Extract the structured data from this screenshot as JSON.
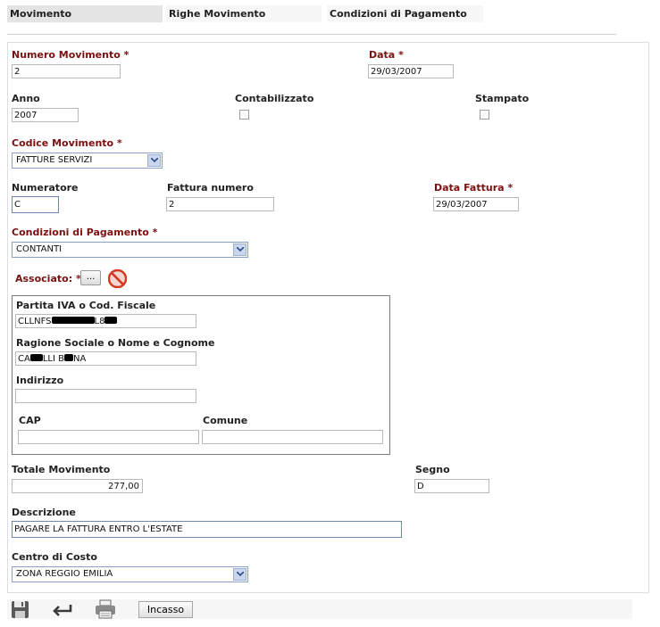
{
  "tabs": [
    {
      "label": "Movimento",
      "active": true
    },
    {
      "label": "Righe Movimento",
      "active": false
    },
    {
      "label": "Condizioni di Pagamento",
      "active": false
    }
  ],
  "form": {
    "numero_movimento": {
      "label": "Numero Movimento",
      "req": "*",
      "value": "2"
    },
    "data": {
      "label": "Data",
      "req": "*",
      "value": "29/03/2007"
    },
    "anno": {
      "label": "Anno",
      "value": "2007"
    },
    "contabilizzato": {
      "label": "Contabilizzato",
      "checked": false
    },
    "stampato": {
      "label": "Stampato",
      "checked": false
    },
    "codice_movimento": {
      "label": "Codice Movimento",
      "req": "*",
      "value": "FATTURE SERVIZI"
    },
    "numeratore": {
      "label": "Numeratore",
      "value": "C"
    },
    "fattura_numero": {
      "label": "Fattura numero",
      "value": "2"
    },
    "data_fattura": {
      "label": "Data Fattura",
      "req": "*",
      "value": "29/03/2007"
    },
    "condizioni_pagamento": {
      "label": "Condizioni di Pagamento",
      "req": "*",
      "value": "CONTANTI"
    },
    "associato": {
      "label": "Associato:",
      "req": "*",
      "button_label": "..."
    },
    "associato_group": {
      "partita_iva": {
        "label": "Partita IVA o Cod. Fiscale",
        "value_prefix": "CLLNFS",
        "value_suffix": "L8"
      },
      "ragione_sociale": {
        "label": "Ragione Sociale o Nome e Cognome",
        "value_prefix": "CA",
        "value_mid": "LLI B",
        "value_suffix": "NA"
      },
      "indirizzo": {
        "label": "Indirizzo",
        "value": ""
      },
      "cap": {
        "label": "CAP",
        "value": ""
      },
      "comune": {
        "label": "Comune",
        "value": ""
      }
    },
    "totale_movimento": {
      "label": "Totale Movimento",
      "value": "277,00"
    },
    "segno": {
      "label": "Segno",
      "value": "D"
    },
    "descrizione": {
      "label": "Descrizione",
      "value": "PAGARE LA FATTURA ENTRO L'ESTATE"
    },
    "centro_di_costo": {
      "label": "Centro di Costo",
      "value": "ZONA REGGIO EMILIA"
    }
  },
  "toolbar": {
    "icons": [
      "save-icon",
      "back-icon",
      "print-icon",
      "delete-icon"
    ],
    "incasso_label": "Incasso"
  },
  "colors": {
    "required_label": "#7a1010",
    "select_border": "#8aa0c8",
    "active_tab": "#e4e4e4"
  }
}
